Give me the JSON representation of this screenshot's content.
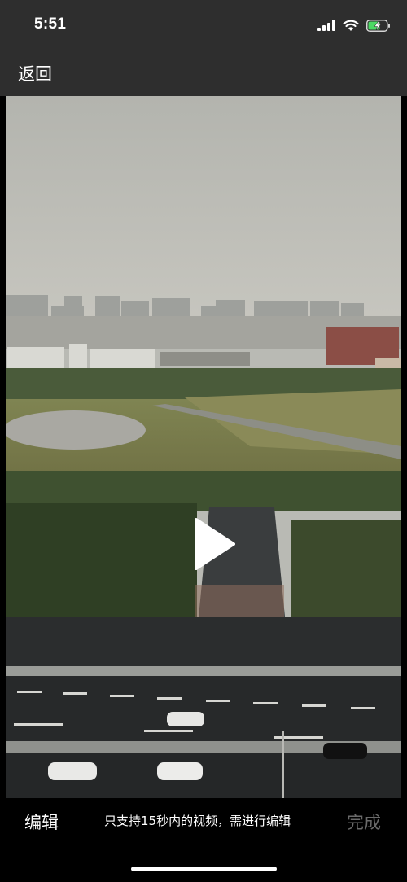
{
  "status_bar": {
    "time": "5:51",
    "icons": [
      "cellular-signal-icon",
      "wifi-icon",
      "battery-charging-icon"
    ],
    "battery_color": "#4cd964"
  },
  "nav": {
    "back_label": "返回"
  },
  "video": {
    "play_icon": "play-icon"
  },
  "bottom_bar": {
    "edit_label": "编辑",
    "hint_text": "只支持15秒内的视频，需进行编辑",
    "done_label": "完成"
  }
}
